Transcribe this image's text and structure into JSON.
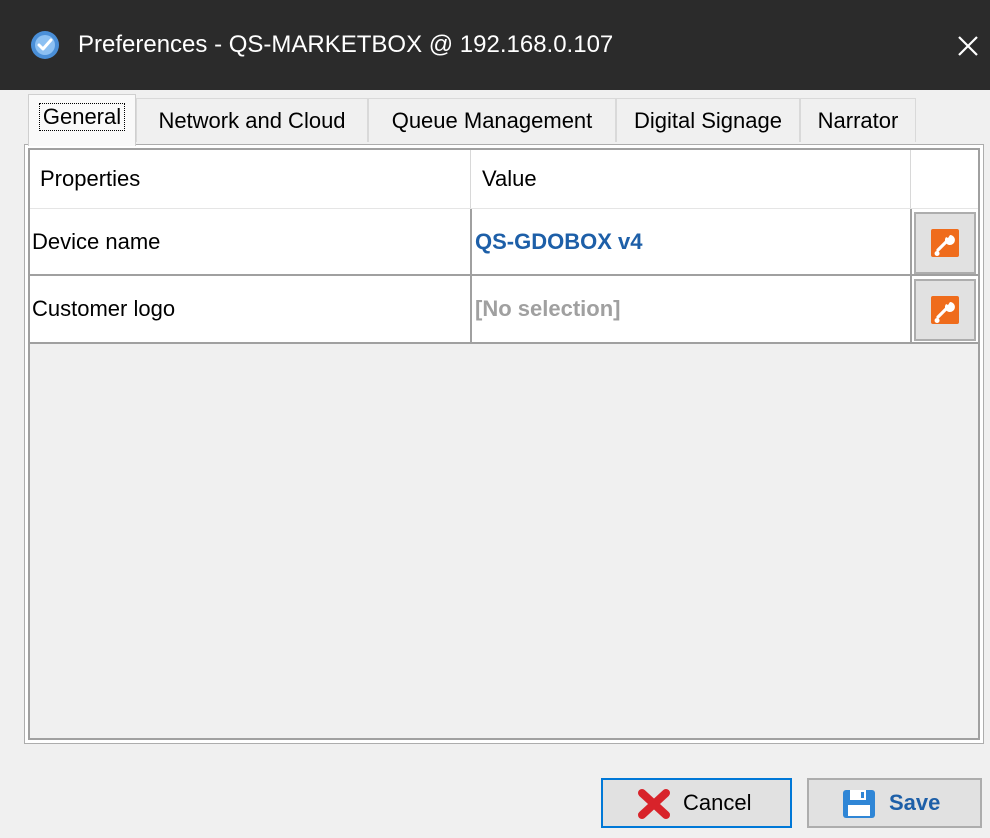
{
  "window": {
    "title": "Preferences - QS-MARKETBOX @ 192.168.0.107",
    "close_glyph": "✕"
  },
  "tabs": [
    {
      "label": "General",
      "active": true
    },
    {
      "label": "Network and Cloud",
      "active": false
    },
    {
      "label": "Queue Management",
      "active": false
    },
    {
      "label": "Digital Signage",
      "active": false
    },
    {
      "label": "Narrator",
      "active": false
    }
  ],
  "grid": {
    "headers": {
      "properties": "Properties",
      "value": "Value"
    },
    "rows": [
      {
        "property": "Device name",
        "value": "QS-GDOBOX v4",
        "value_color": "#1d5fa8",
        "action_icon": "wrench-icon"
      },
      {
        "property": "Customer logo",
        "value": "[No selection]",
        "value_color": "#a0a0a0",
        "action_icon": "wrench-icon"
      }
    ]
  },
  "buttons": {
    "cancel": {
      "label": "Cancel",
      "icon": "red-x-icon"
    },
    "save": {
      "label": "Save",
      "icon": "floppy-disk-icon"
    }
  },
  "colors": {
    "titlebar": "#2b2b2b",
    "accent_blue": "#1d5fa8",
    "focus_border": "#0078d7",
    "tool_button_orange": "#ef6c1c",
    "cancel_icon_red": "#d8232a"
  }
}
